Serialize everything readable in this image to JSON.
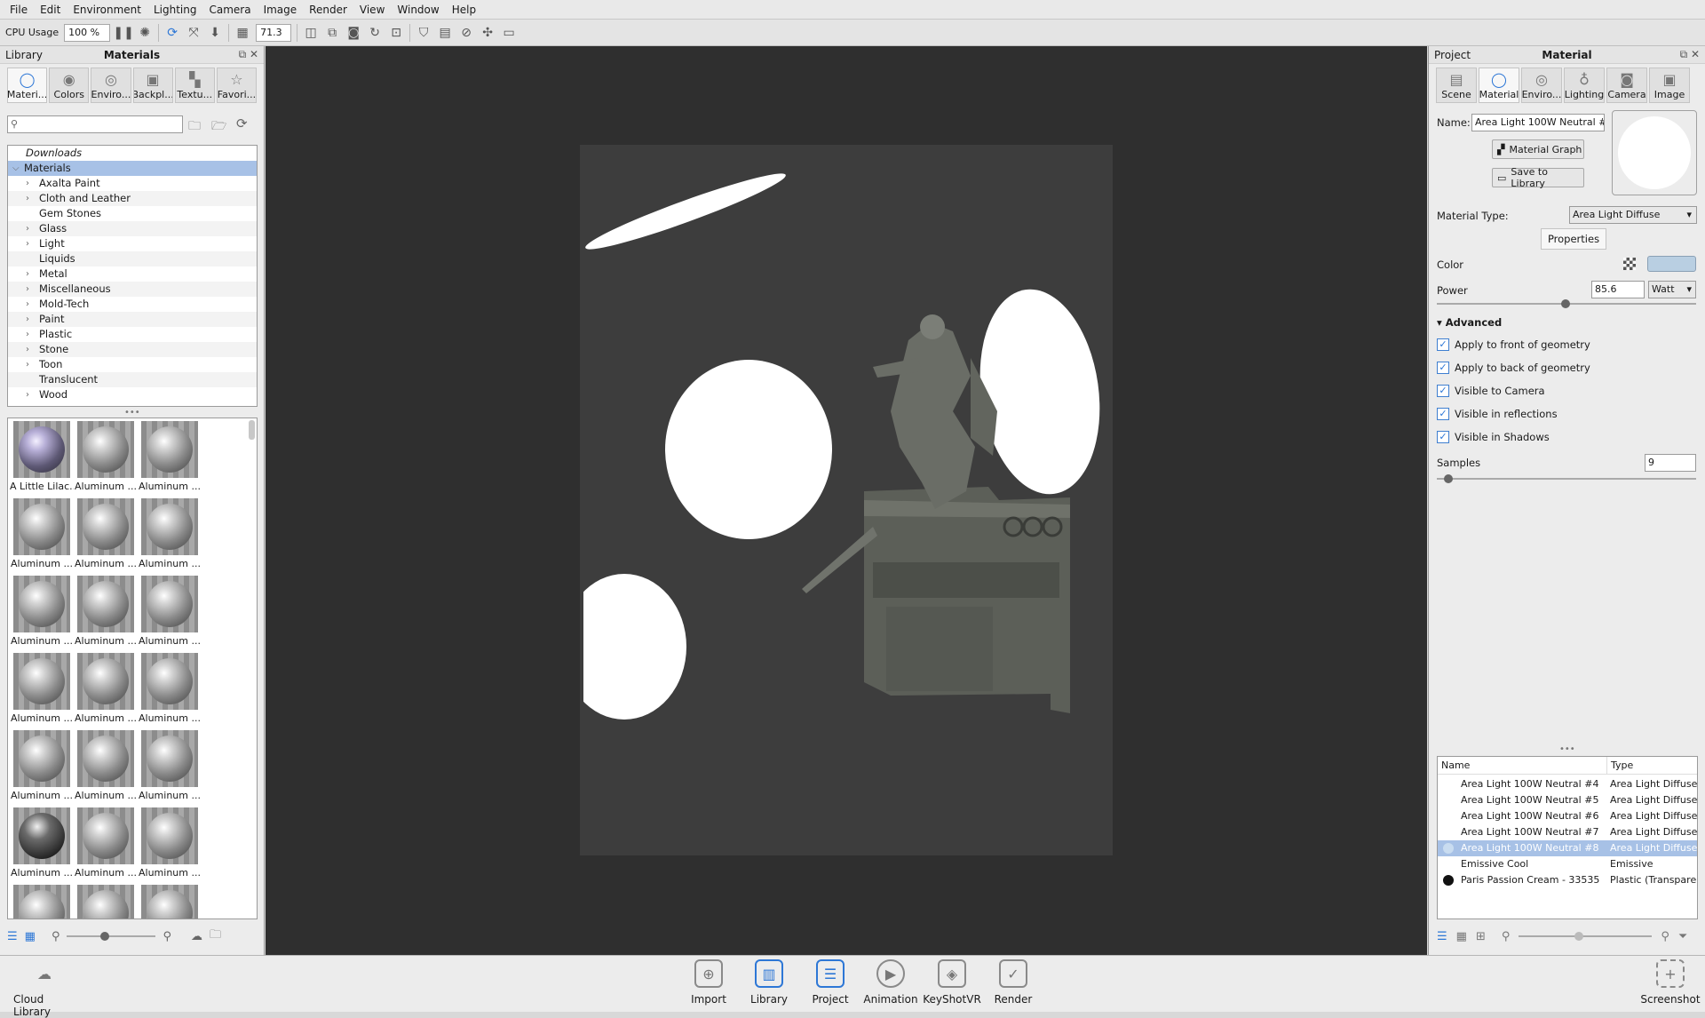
{
  "menu": [
    "File",
    "Edit",
    "Environment",
    "Lighting",
    "Camera",
    "Image",
    "Render",
    "View",
    "Window",
    "Help"
  ],
  "toolbar": {
    "cpu_label": "CPU Usage",
    "cpu_value": "100 %",
    "zoom_value": "71.3"
  },
  "left_panel": {
    "header_left": "Library",
    "header_title": "Materials",
    "tabs": [
      "Materi...",
      "Colors",
      "Enviro...",
      "Backpl...",
      "Textu...",
      "Favori..."
    ],
    "tree": {
      "downloads": "Downloads",
      "root": "Materials",
      "items": [
        "Axalta Paint",
        "Cloth and Leather",
        "Gem Stones",
        "Glass",
        "Light",
        "Liquids",
        "Metal",
        "Miscellaneous",
        "Mold-Tech",
        "Paint",
        "Plastic",
        "Stone",
        "Toon",
        "Translucent",
        "Wood"
      ]
    },
    "thumbnails": [
      "A Little Lilac...",
      "Aluminum ...",
      "Aluminum ...",
      "Aluminum ...",
      "Aluminum ...",
      "Aluminum ...",
      "Aluminum ...",
      "Aluminum ...",
      "Aluminum ...",
      "Aluminum ...",
      "Aluminum ...",
      "Aluminum ...",
      "Aluminum ...",
      "Aluminum ...",
      "Aluminum ...",
      "Aluminum ...",
      "Aluminum ...",
      "Aluminum ...",
      "",
      "",
      ""
    ]
  },
  "right_panel": {
    "header_left": "Project",
    "header_title": "Material",
    "tabs": [
      "Scene",
      "Material",
      "Enviro...",
      "Lighting",
      "Camera",
      "Image"
    ],
    "name_label": "Name:",
    "name_value": "Area Light 100W Neutral #8",
    "material_graph": "Material Graph",
    "save_to_library": "Save to Library",
    "material_type_label": "Material Type:",
    "material_type_value": "Area Light Diffuse",
    "properties_tab": "Properties",
    "color_label": "Color",
    "power_label": "Power",
    "power_value": "85.6",
    "power_unit": "Watt",
    "advanced_label": "Advanced",
    "checks": [
      "Apply to front of geometry",
      "Apply to back of geometry",
      "Visible to Camera",
      "Visible in reflections",
      "Visible in Shadows"
    ],
    "samples_label": "Samples",
    "samples_value": "9",
    "color_swatch": "#b9cfe2",
    "table_headers": {
      "name": "Name",
      "type": "Type"
    },
    "materials": [
      {
        "name": "Area Light 100W Neutral #4",
        "type": "Area Light Diffuse"
      },
      {
        "name": "Area Light 100W Neutral #5",
        "type": "Area Light Diffuse"
      },
      {
        "name": "Area Light 100W Neutral #6",
        "type": "Area Light Diffuse"
      },
      {
        "name": "Area Light 100W Neutral #7",
        "type": "Area Light Diffuse"
      },
      {
        "name": "Area Light 100W Neutral #8",
        "type": "Area Light Diffuse"
      },
      {
        "name": "Emissive Cool",
        "type": "Emissive"
      },
      {
        "name": "Paris Passion Cream - 33535",
        "type": "Plastic (Transparen"
      }
    ]
  },
  "bottom": {
    "cloud_library": "Cloud Library",
    "buttons": [
      "Import",
      "Library",
      "Project",
      "Animation",
      "KeyShotVR",
      "Render"
    ],
    "screenshot": "Screenshot"
  }
}
